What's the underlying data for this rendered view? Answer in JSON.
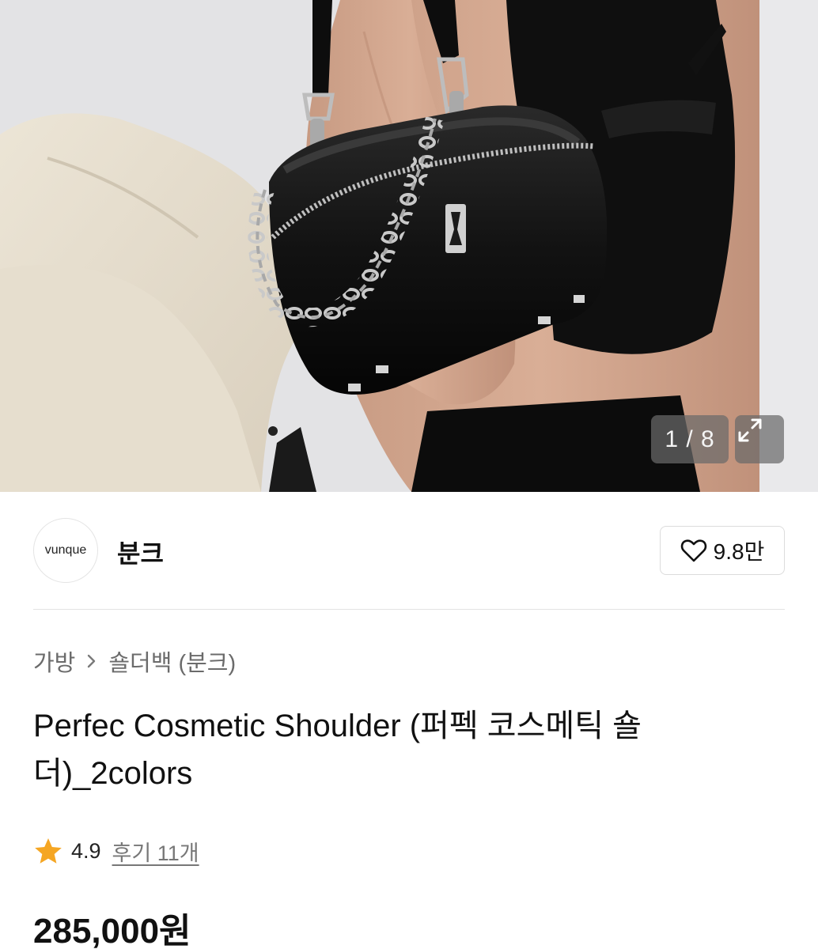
{
  "gallery": {
    "image_alt": "Perfec Cosmetic Shoulder bag photo",
    "current_index": "1",
    "total": "8",
    "counter_text": "1 / 8",
    "expand_icon": "expand-icon"
  },
  "brand": {
    "logo_text": "vunque",
    "name": "분크",
    "like_icon": "heart-outline-icon",
    "like_count": "9.8만"
  },
  "breadcrumb": {
    "items": [
      "가방",
      "숄더백 (분크)"
    ],
    "separator_icon": "chevron-right-icon"
  },
  "product": {
    "title": "Perfec Cosmetic Shoulder (퍼펙 코스메틱 숄더)_2colors",
    "rating": "4.9",
    "rating_icon": "star-icon",
    "review_label": "후기 11개",
    "price": "285,000원"
  },
  "colors": {
    "star": "#f5a623",
    "text_primary": "#111111",
    "text_secondary": "#6b6b6b"
  }
}
